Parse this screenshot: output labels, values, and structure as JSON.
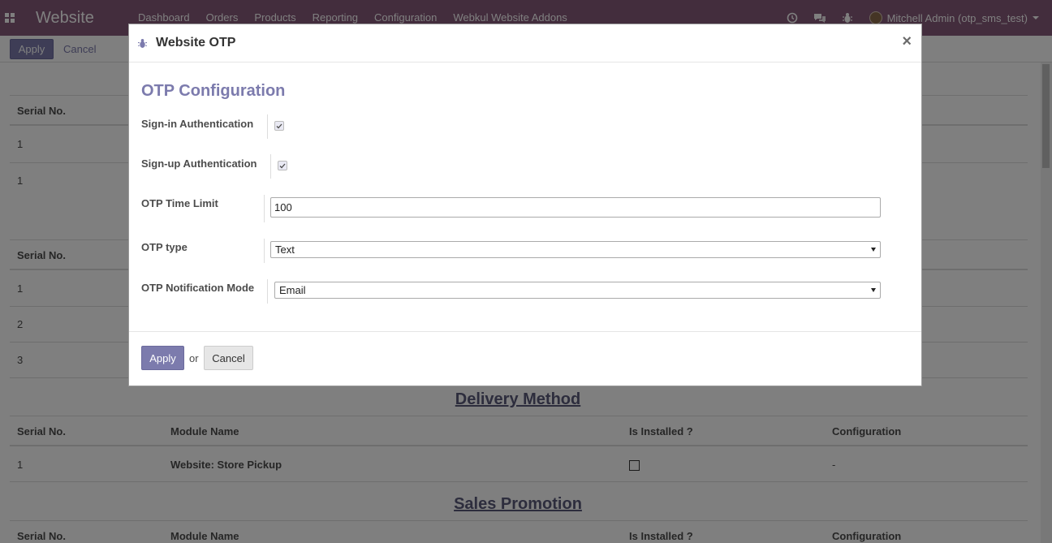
{
  "navbar": {
    "brand": "Website",
    "menu": [
      "Dashboard",
      "Orders",
      "Products",
      "Reporting",
      "Configuration",
      "Webkul Website Addons"
    ],
    "user": "Mitchell Admin (otp_sms_test)"
  },
  "control_panel": {
    "apply_label": "Apply",
    "cancel_label": "Cancel"
  },
  "background": {
    "table1": {
      "header": [
        "Serial No."
      ],
      "rows": [
        "1",
        "1"
      ]
    },
    "table2": {
      "header": [
        "Serial No."
      ],
      "rows": [
        "1",
        "2",
        "3"
      ]
    },
    "delivery": {
      "title": "Delivery Method",
      "headers": [
        "Serial No.",
        "Module Name",
        "Is Installed ?",
        "Configuration"
      ],
      "row": {
        "serial": "1",
        "module": "Website: Store Pickup",
        "config": "-"
      }
    },
    "promotion": {
      "title": "Sales Promotion",
      "headers": [
        "Serial No.",
        "Module Name",
        "Is Installed ?",
        "Configuration"
      ]
    }
  },
  "modal": {
    "title": "Website OTP",
    "close_symbol": "×",
    "section_heading": "OTP Configuration",
    "fields": {
      "signin": {
        "label": "Sign-in Authentication",
        "checked": true
      },
      "signup": {
        "label": "Sign-up Authentication",
        "checked": true
      },
      "time_limit": {
        "label": "OTP Time Limit",
        "value": "100"
      },
      "otp_type": {
        "label": "OTP type",
        "value": "Text"
      },
      "notification_mode": {
        "label": "OTP Notification Mode",
        "value": "Email"
      }
    },
    "footer": {
      "apply_label": "Apply",
      "or_text": "or",
      "cancel_label": "Cancel"
    }
  },
  "colors": {
    "navbar": "#875a7b",
    "primary": "#7c7bad"
  }
}
